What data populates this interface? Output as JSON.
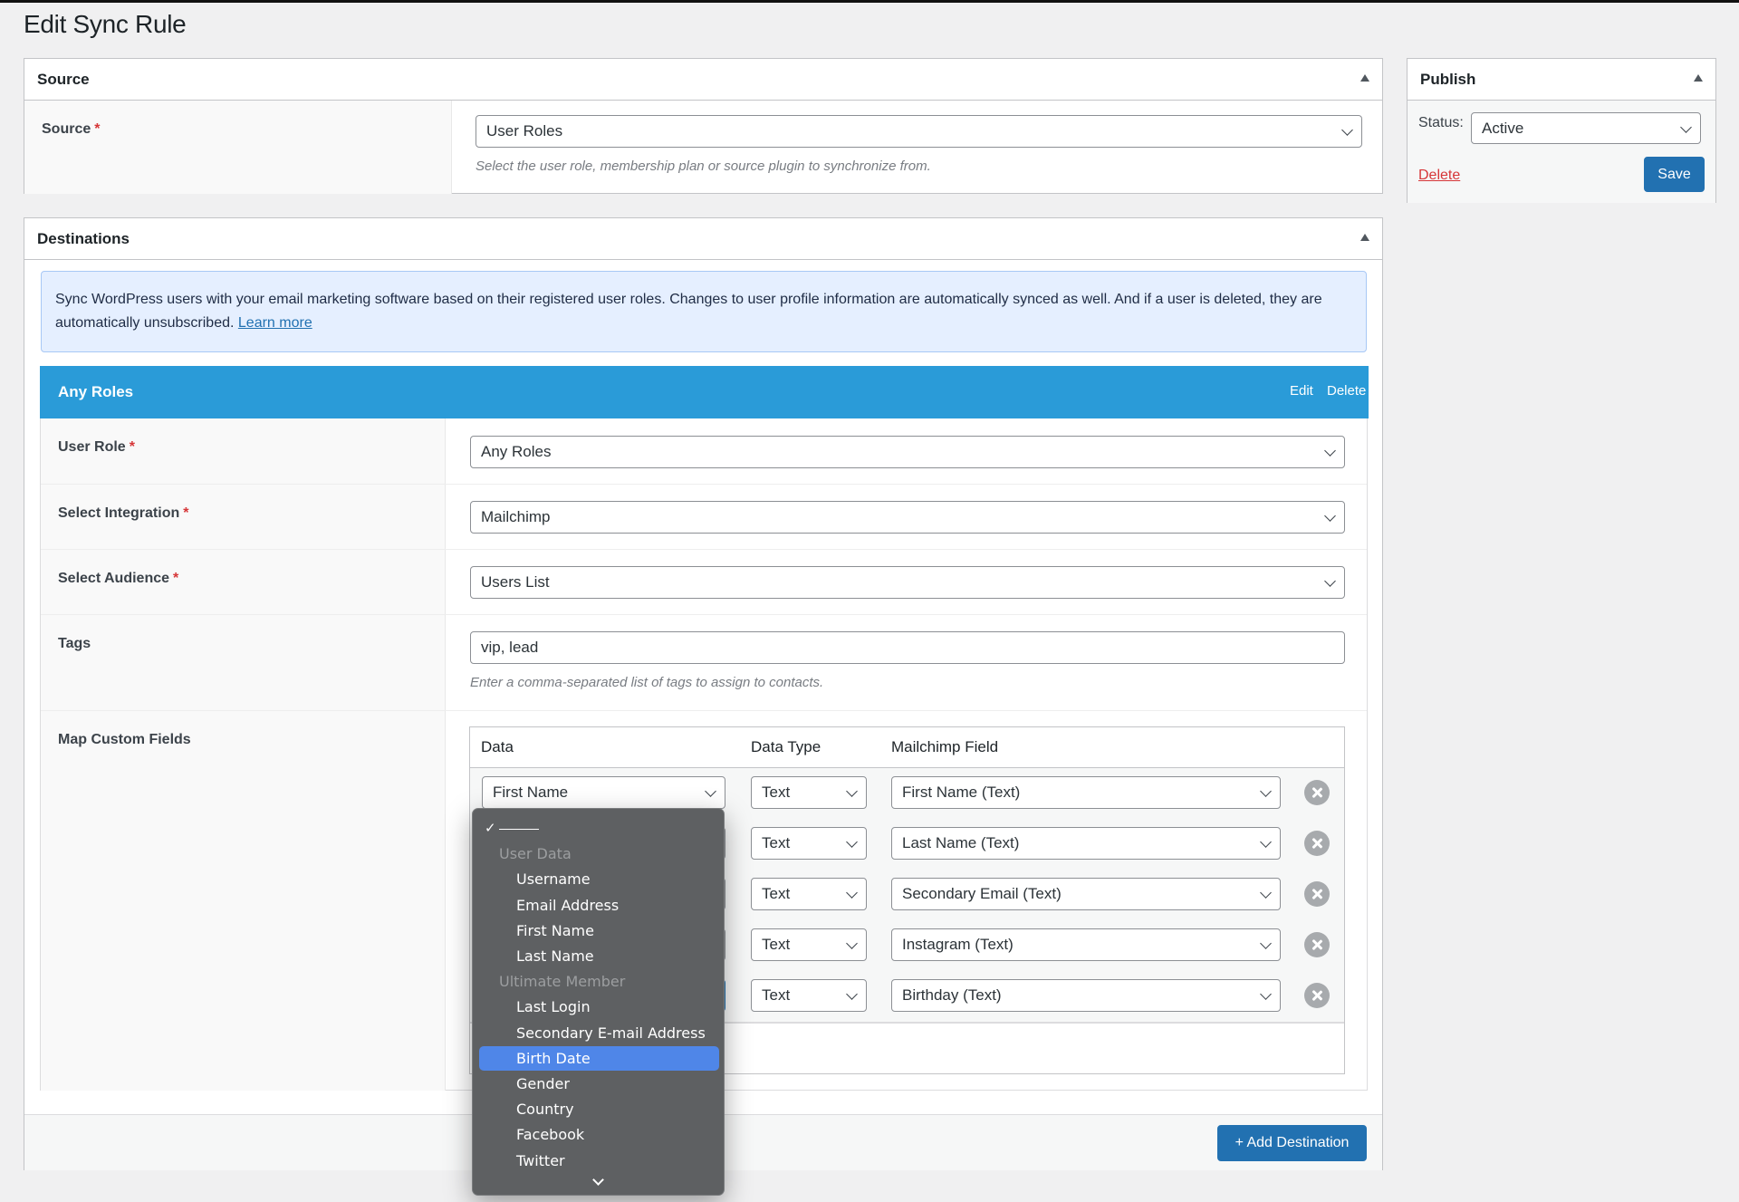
{
  "page": {
    "title": "Edit Sync Rule"
  },
  "source_box": {
    "title": "Source",
    "field_label": "Source",
    "required_mark": "*",
    "select_value": "User Roles",
    "description": "Select the user role, membership plan or source plugin to synchronize from."
  },
  "publish_box": {
    "title": "Publish",
    "status_label": "Status:",
    "status_value": "Active",
    "delete_label": "Delete",
    "save_label": "Save"
  },
  "destinations_box": {
    "title": "Destinations",
    "notice_text": "Sync WordPress users with your email marketing software based on their registered user roles. Changes to user profile information are automatically synced as well. And if a user is deleted, they are automatically unsubscribed.",
    "notice_link": "Learn more",
    "add_destination_label": "+ Add Destination",
    "card": {
      "title": "Any Roles",
      "edit_label": "Edit",
      "delete_label": "Delete",
      "fields": {
        "user_role": {
          "label": "User Role",
          "value": "Any Roles"
        },
        "integration": {
          "label": "Select Integration",
          "value": "Mailchimp"
        },
        "audience": {
          "label": "Select Audience",
          "value": "Users List"
        },
        "tags": {
          "label": "Tags",
          "value": "vip, lead",
          "description": "Enter a comma-separated list of tags to assign to contacts."
        },
        "map": {
          "label": "Map Custom Fields"
        }
      },
      "required_mark": "*",
      "map_table": {
        "headers": [
          "Data",
          "Data Type",
          "Mailchimp Field"
        ],
        "rows": [
          {
            "data": "First Name",
            "type": "Text",
            "field": "First Name (Text)"
          },
          {
            "data": "",
            "type": "Text",
            "field": "Last Name (Text)"
          },
          {
            "data": "",
            "type": "Text",
            "field": "Secondary Email (Text)"
          },
          {
            "data": "",
            "type": "Text",
            "field": "Instagram (Text)"
          },
          {
            "data": "",
            "type": "Text",
            "field": "Birthday (Text)"
          }
        ]
      }
    }
  },
  "dropdown": {
    "checked_placeholder": "✓",
    "items": [
      {
        "label": "",
        "kind": "check"
      },
      {
        "label": "User Data",
        "kind": "group"
      },
      {
        "label": "Username",
        "kind": "option"
      },
      {
        "label": "Email Address",
        "kind": "option"
      },
      {
        "label": "First Name",
        "kind": "option"
      },
      {
        "label": "Last Name",
        "kind": "option"
      },
      {
        "label": "Ultimate Member",
        "kind": "group"
      },
      {
        "label": "Last Login",
        "kind": "option"
      },
      {
        "label": "Secondary E-mail Address",
        "kind": "option"
      },
      {
        "label": "Birth Date",
        "kind": "option",
        "highlighted": true
      },
      {
        "label": "Gender",
        "kind": "option"
      },
      {
        "label": "Country",
        "kind": "option"
      },
      {
        "label": "Facebook",
        "kind": "option"
      },
      {
        "label": "Twitter",
        "kind": "option"
      }
    ]
  },
  "colors": {
    "accent": "#2271b1",
    "card_header": "#2a9bd8",
    "danger": "#d63638",
    "dropdown_highlight": "#4f86e8"
  }
}
